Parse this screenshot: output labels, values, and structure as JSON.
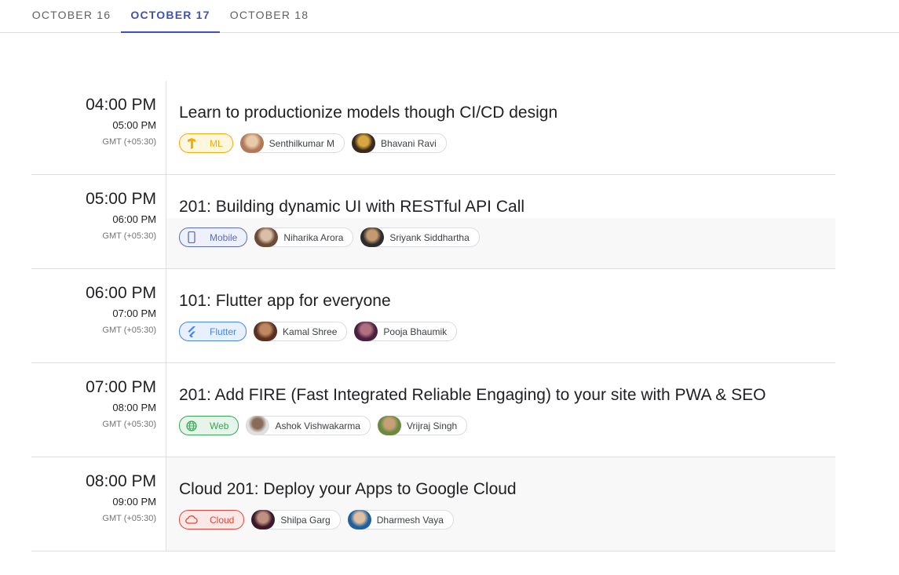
{
  "tabs": [
    {
      "label": "OCTOBER 16",
      "active": false
    },
    {
      "label": "OCTOBER 17",
      "active": true
    },
    {
      "label": "OCTOBER 18",
      "active": false
    }
  ],
  "sessions": [
    {
      "start": "04:00 PM",
      "end": "05:00 PM",
      "tz": "GMT (+05:30)",
      "title": "Learn to productionize models though CI/CD design",
      "tag": {
        "label": "ML",
        "icon": "tensorflow-icon",
        "color": "#f9ab00",
        "bg": "#fef7e0"
      },
      "speakers": [
        {
          "name": "Senthilkumar M",
          "avatar_colors": [
            "#b07a5a",
            "#e8c9a8"
          ]
        },
        {
          "name": "Bhavani Ravi",
          "avatar_colors": [
            "#3a2a1c",
            "#d8a640"
          ]
        }
      ]
    },
    {
      "start": "05:00 PM",
      "end": "06:00 PM",
      "tz": "GMT (+05:30)",
      "title": "201: Building dynamic UI with RESTful API Call",
      "tag": {
        "label": "Mobile",
        "icon": "smartphone-icon",
        "color": "#5c6bc0",
        "bg": "#eef0fb"
      },
      "speakers": [
        {
          "name": "Niharika Arora",
          "avatar_colors": [
            "#6b4a38",
            "#d9bfa8"
          ]
        },
        {
          "name": "Sriyank Siddhartha",
          "avatar_colors": [
            "#2c2c2c",
            "#c69a70"
          ]
        }
      ]
    },
    {
      "start": "06:00 PM",
      "end": "07:00 PM",
      "tz": "GMT (+05:30)",
      "title": "101: Flutter app for everyone",
      "tag": {
        "label": "Flutter",
        "icon": "flutter-icon",
        "color": "#4285f4",
        "bg": "#e8f0fe"
      },
      "speakers": [
        {
          "name": "Kamal Shree",
          "avatar_colors": [
            "#5a3020",
            "#c08860"
          ]
        },
        {
          "name": "Pooja Bhaumik",
          "avatar_colors": [
            "#4a2040",
            "#b07080"
          ]
        }
      ]
    },
    {
      "start": "07:00 PM",
      "end": "08:00 PM",
      "tz": "GMT (+05:30)",
      "title": "201: Add FIRE (Fast Integrated Reliable Engaging) to your site with PWA & SEO",
      "tag": {
        "label": "Web",
        "icon": "globe-icon",
        "color": "#34a853",
        "bg": "#e6f4ea"
      },
      "speakers": [
        {
          "name": "Ashok Vishwakarma",
          "avatar_colors": [
            "#e0e0e0",
            "#8a6a58"
          ]
        },
        {
          "name": "Vrijraj Singh",
          "avatar_colors": [
            "#6a8a40",
            "#c8a078"
          ]
        }
      ]
    },
    {
      "start": "08:00 PM",
      "end": "09:00 PM",
      "tz": "GMT (+05:30)",
      "title": "Cloud 201: Deploy your Apps to Google Cloud",
      "tag": {
        "label": "Cloud",
        "icon": "cloud-icon",
        "color": "#ea4335",
        "bg": "#fce8e6"
      },
      "speakers": [
        {
          "name": "Shilpa Garg",
          "avatar_colors": [
            "#3a1a28",
            "#c09080"
          ]
        },
        {
          "name": "Dharmesh Vaya",
          "avatar_colors": [
            "#2060a0",
            "#e0c0a0"
          ]
        }
      ]
    }
  ]
}
